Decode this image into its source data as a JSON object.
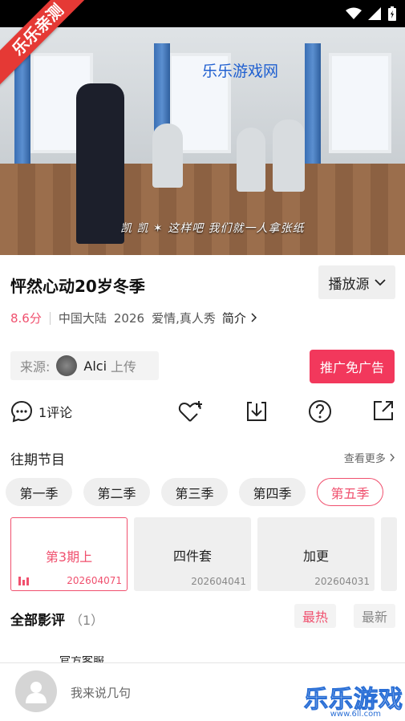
{
  "ribbon": "乐乐亲测",
  "video": {
    "watermark": "乐乐游戏网",
    "subtitle": "凯 凯 ✶  这样吧 我们就一人拿张纸"
  },
  "show": {
    "title": "怦然心动20岁冬季",
    "source_button": "播放源",
    "score": "8.6分",
    "region": "中国大陆",
    "year": "2026",
    "genres": "爱情,真人秀",
    "intro": "简介"
  },
  "uploader": {
    "label": "来源:",
    "name": "Alci",
    "suffix": "上传"
  },
  "promo_button": "推广免广告",
  "actions": {
    "comment_count": "1评论"
  },
  "episodes_section": {
    "title": "往期节目",
    "more": "查看更多"
  },
  "seasons": [
    "第一季",
    "第二季",
    "第三季",
    "第四季",
    "第五季"
  ],
  "active_season": "第五季",
  "episodes": [
    {
      "name": "第3期上",
      "date": "202604071",
      "active": true
    },
    {
      "name": "四件套",
      "date": "202604041",
      "active": false
    },
    {
      "name": "加更",
      "date": "202604031",
      "active": false
    }
  ],
  "reviews": {
    "title": "全部影评",
    "count": "（1）",
    "sort_hot": "最热",
    "sort_new": "最新",
    "first_name": "官方客服"
  },
  "bottom": {
    "placeholder": "我来说几句",
    "logo": "乐乐游戏",
    "logo_url": "www.6ll.com"
  },
  "colors": {
    "accent": "#f0506e",
    "promo": "#f2385c"
  }
}
